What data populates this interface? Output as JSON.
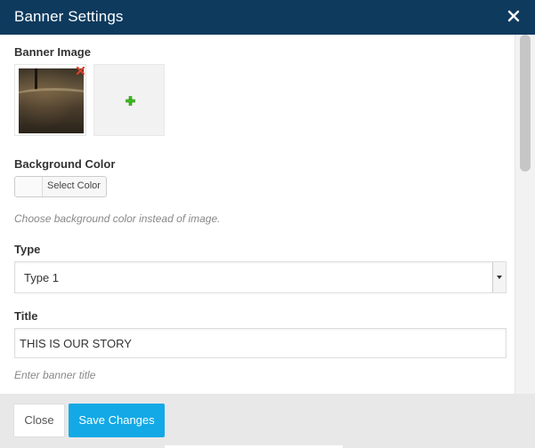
{
  "dialog": {
    "title": "Banner Settings",
    "close_icon": "close-icon"
  },
  "form": {
    "banner_image": {
      "label": "Banner Image",
      "remove_icon": "remove-x-icon",
      "add_icon": "plus-icon"
    },
    "background_color": {
      "label": "Background Color",
      "button_label": "Select Color",
      "hint": "Choose background color instead of image."
    },
    "type": {
      "label": "Type",
      "selected": "Type 1"
    },
    "title": {
      "label": "Title",
      "value": "THIS IS OUR STORY",
      "hint": "Enter banner title"
    }
  },
  "footer": {
    "close_label": "Close",
    "save_label": "Save Changes"
  },
  "colors": {
    "header_bg": "#0e3a5e",
    "save_button": "#12a9e6",
    "remove_icon": "#e0402a",
    "add_icon": "#3fbf1f"
  }
}
